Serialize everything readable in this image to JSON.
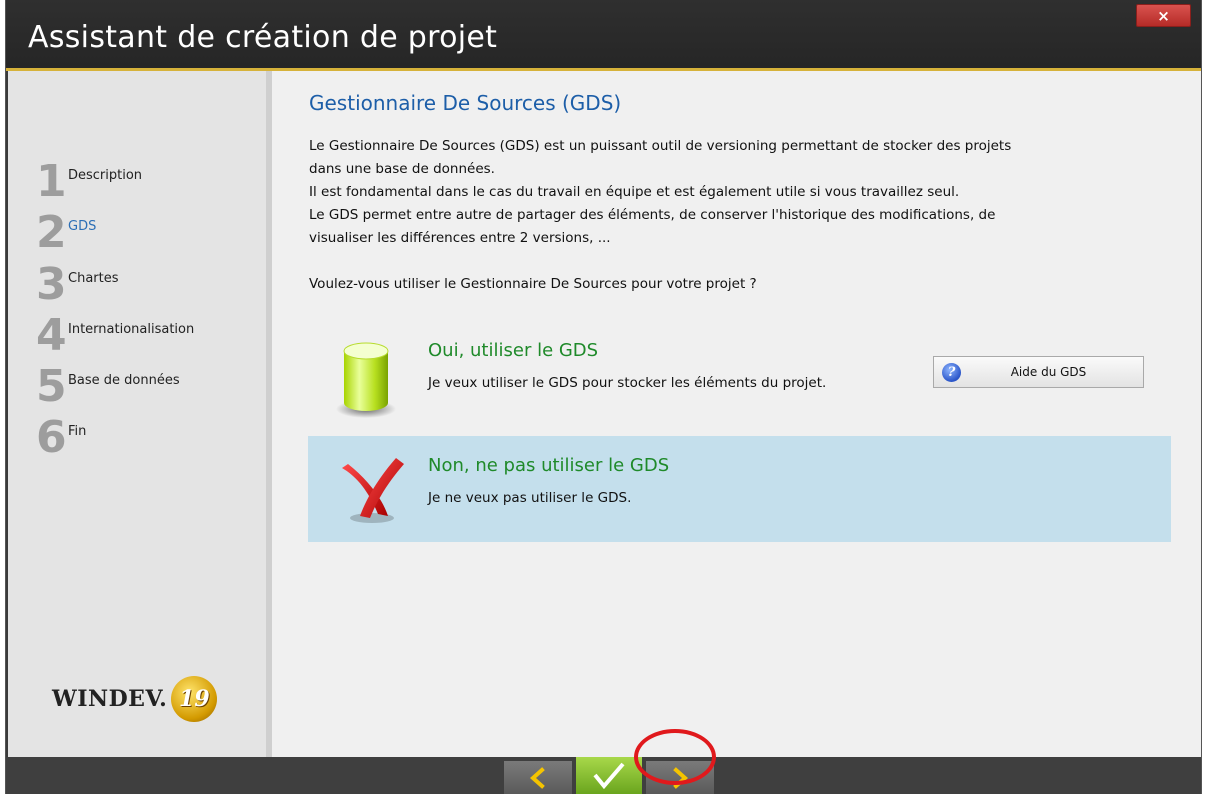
{
  "window": {
    "title": "Assistant de création de projet",
    "close_label": "×"
  },
  "steps": [
    {
      "number": "1",
      "label": "Description",
      "active": false
    },
    {
      "number": "2",
      "label": "GDS",
      "active": true
    },
    {
      "number": "3",
      "label": "Chartes",
      "active": false
    },
    {
      "number": "4",
      "label": "Internationalisation",
      "active": false
    },
    {
      "number": "5",
      "label": "Base de données",
      "active": false
    },
    {
      "number": "6",
      "label": "Fin",
      "active": false
    }
  ],
  "logo": {
    "text": "WINDEV.",
    "version": "19"
  },
  "main": {
    "heading": "Gestionnaire De Sources (GDS)",
    "description_lines": [
      "Le Gestionnaire De Sources (GDS) est un puissant outil de versioning permettant de stocker des projets",
      "dans une base de données.",
      "Il est fondamental dans le cas du travail en équipe et est également utile si vous travaillez seul.",
      "Le GDS permet entre autre de partager des éléments, de conserver l'historique des modifications, de",
      "visualiser les différences entre 2 versions, ..."
    ],
    "question": "Voulez-vous utiliser le Gestionnaire De Sources pour votre projet ?"
  },
  "options": {
    "yes": {
      "title": "Oui, utiliser le GDS",
      "description": "Je veux utiliser le GDS pour stocker les éléments du projet.",
      "selected": false,
      "help_button": "Aide du GDS"
    },
    "no": {
      "title": "Non, ne pas utiliser le GDS",
      "description": "Je ne veux pas utiliser le GDS.",
      "selected": true
    }
  },
  "nav": {
    "prev_icon": "chevron-left-icon",
    "ok_icon": "checkmark-icon",
    "next_icon": "chevron-right-icon"
  },
  "colors": {
    "accent_gold": "#d6b23a",
    "heading_blue": "#1d5ea8",
    "option_green": "#1f8a2a",
    "selected_bg": "#c4dfec",
    "highlight_red": "#e0191c"
  }
}
